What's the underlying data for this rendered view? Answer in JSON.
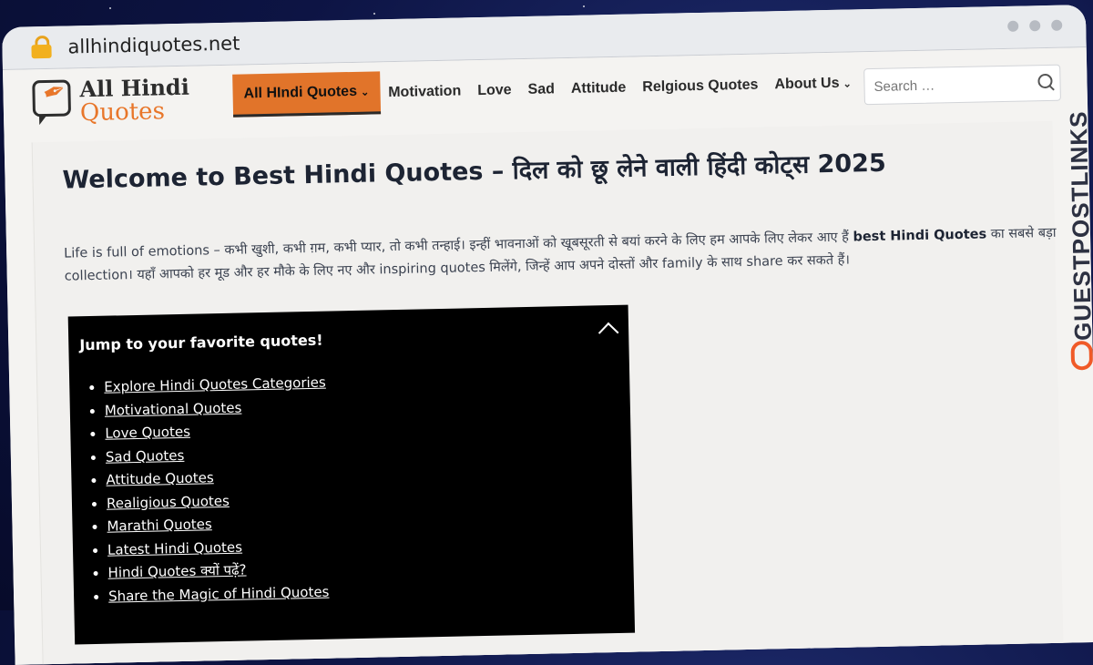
{
  "browser": {
    "url": "allhindiquotes.net"
  },
  "logo": {
    "line1": "All Hindi",
    "line2": "Quotes"
  },
  "nav": {
    "items": [
      {
        "label": "All HIndi Quotes",
        "dropdown": true,
        "active": true
      },
      {
        "label": "Motivation"
      },
      {
        "label": "Love"
      },
      {
        "label": "Sad"
      },
      {
        "label": "Attitude"
      },
      {
        "label": "Relgious Quotes"
      },
      {
        "label": "About Us",
        "dropdown": true
      }
    ],
    "search_placeholder": "Search …"
  },
  "side_badge": {
    "text": "GUESTPOSTLINKS",
    "accent": "#f05a28"
  },
  "main": {
    "title": "Welcome to Best Hindi Quotes – दिल को छू लेने वाली हिंदी कोट्स 2025",
    "intro_part1": "Life is full of emotions – कभी खुशी, कभी ग़म, कभी प्यार, तो कभी तन्हाई। इन्हीं भावनाओं को खूबसूरती से बयां करने के लिए हम आपके लिए लेकर आए हैं ",
    "intro_bold": "best Hindi Quotes",
    "intro_part2": " का सबसे बड़ा collection। यहाँ आपको हर मूड और हर मौके के लिए नए और inspiring quotes मिलेंगे, जिन्हें आप अपने दोस्तों और family के साथ share कर सकते हैं।",
    "toc": {
      "heading": "Jump to your favorite quotes!",
      "items": [
        "Explore Hindi Quotes Categories",
        "Motivational Quotes",
        "Love Quotes",
        "Sad Quotes",
        "Attitude Quotes",
        "Realigious Quotes",
        "Marathi Quotes",
        "Latest Hindi Quotes",
        "Hindi Quotes क्यों पढ़ें?",
        "Share the Magic of Hindi Quotes"
      ]
    }
  },
  "colors": {
    "brand_orange": "#e1742a",
    "toc_bg": "#000000",
    "text_dark": "#1d2433"
  }
}
